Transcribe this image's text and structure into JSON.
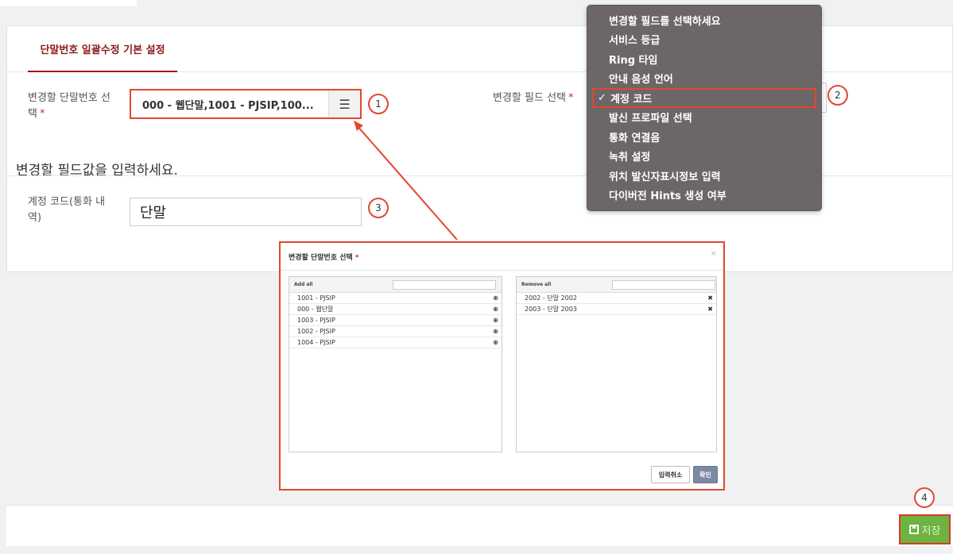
{
  "card": {
    "tab_label": "단말번호 일괄수정 기본 설정"
  },
  "form": {
    "terminal_label": "변경할 단말번호 선택",
    "terminal_label_line1": "변경할 단말번호 선",
    "terminal_label_line2": "택",
    "required_mark": "*",
    "terminal_value": "000 - 웹단말,1001 - PJSIP,100...",
    "list_icon": "list-icon",
    "field_label": "변경할 필드 선택",
    "section_title": "변경할 필드값을 입력하세요.",
    "account_label_line1": "계정 코드(통화 내",
    "account_label_line2": "역)",
    "account_value": "단말"
  },
  "dropdown": {
    "items": [
      {
        "label": "변경할 필드를 선택하세요"
      },
      {
        "label": "서비스 등급"
      },
      {
        "label": "Ring 타임"
      },
      {
        "label": "안내 음성 언어"
      },
      {
        "label": "계정 코드",
        "selected": true
      },
      {
        "label": "발신 프로파일 선택"
      },
      {
        "label": "통화 연결음"
      },
      {
        "label": "녹취 설정"
      },
      {
        "label": "위치 발신자표시정보 입력"
      },
      {
        "label": "다이버전 Hints 생성 여부"
      }
    ],
    "check_mark": "✓"
  },
  "modal": {
    "title": "변경할 단말번호 선택",
    "close": "×",
    "add_all": "Add all",
    "remove_all": "Remove all",
    "available": [
      "1001 - PJSIP",
      "000 - 웹단말",
      "1003 - PJSIP",
      "1002 - PJSIP",
      "1004 - PJSIP"
    ],
    "selected": [
      "2002 - 단말 2002",
      "2003 - 단말 2003"
    ],
    "add_icon": "⊕",
    "remove_icon": "✖",
    "cancel_label": "입력취소",
    "ok_label": "확인"
  },
  "callouts": {
    "c1": "1",
    "c2": "2",
    "c3": "3",
    "c4": "4"
  },
  "footer": {
    "save_label": "저장"
  },
  "colors": {
    "accent_red": "#e0482f",
    "tab_red": "#8b1a1a",
    "save_green": "#6cb33f",
    "dropdown_bg": "#6c6666"
  }
}
